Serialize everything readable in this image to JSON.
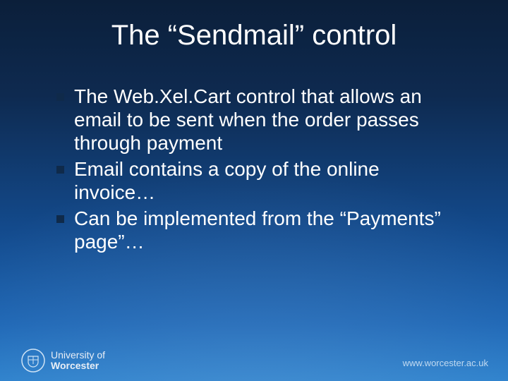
{
  "title": "The “Sendmail” control",
  "bullets": [
    "The Web.Xel.Cart control that allows an email to be sent when the order passes through payment",
    "Email contains a copy of the online invoice…",
    "Can be implemented from the “Payments” page”…"
  ],
  "footer": {
    "institution_line1": "University of",
    "institution_line2": "Worcester",
    "url": "www.worcester.ac.uk"
  },
  "colors": {
    "bullet_square": "#0f2a4a"
  }
}
